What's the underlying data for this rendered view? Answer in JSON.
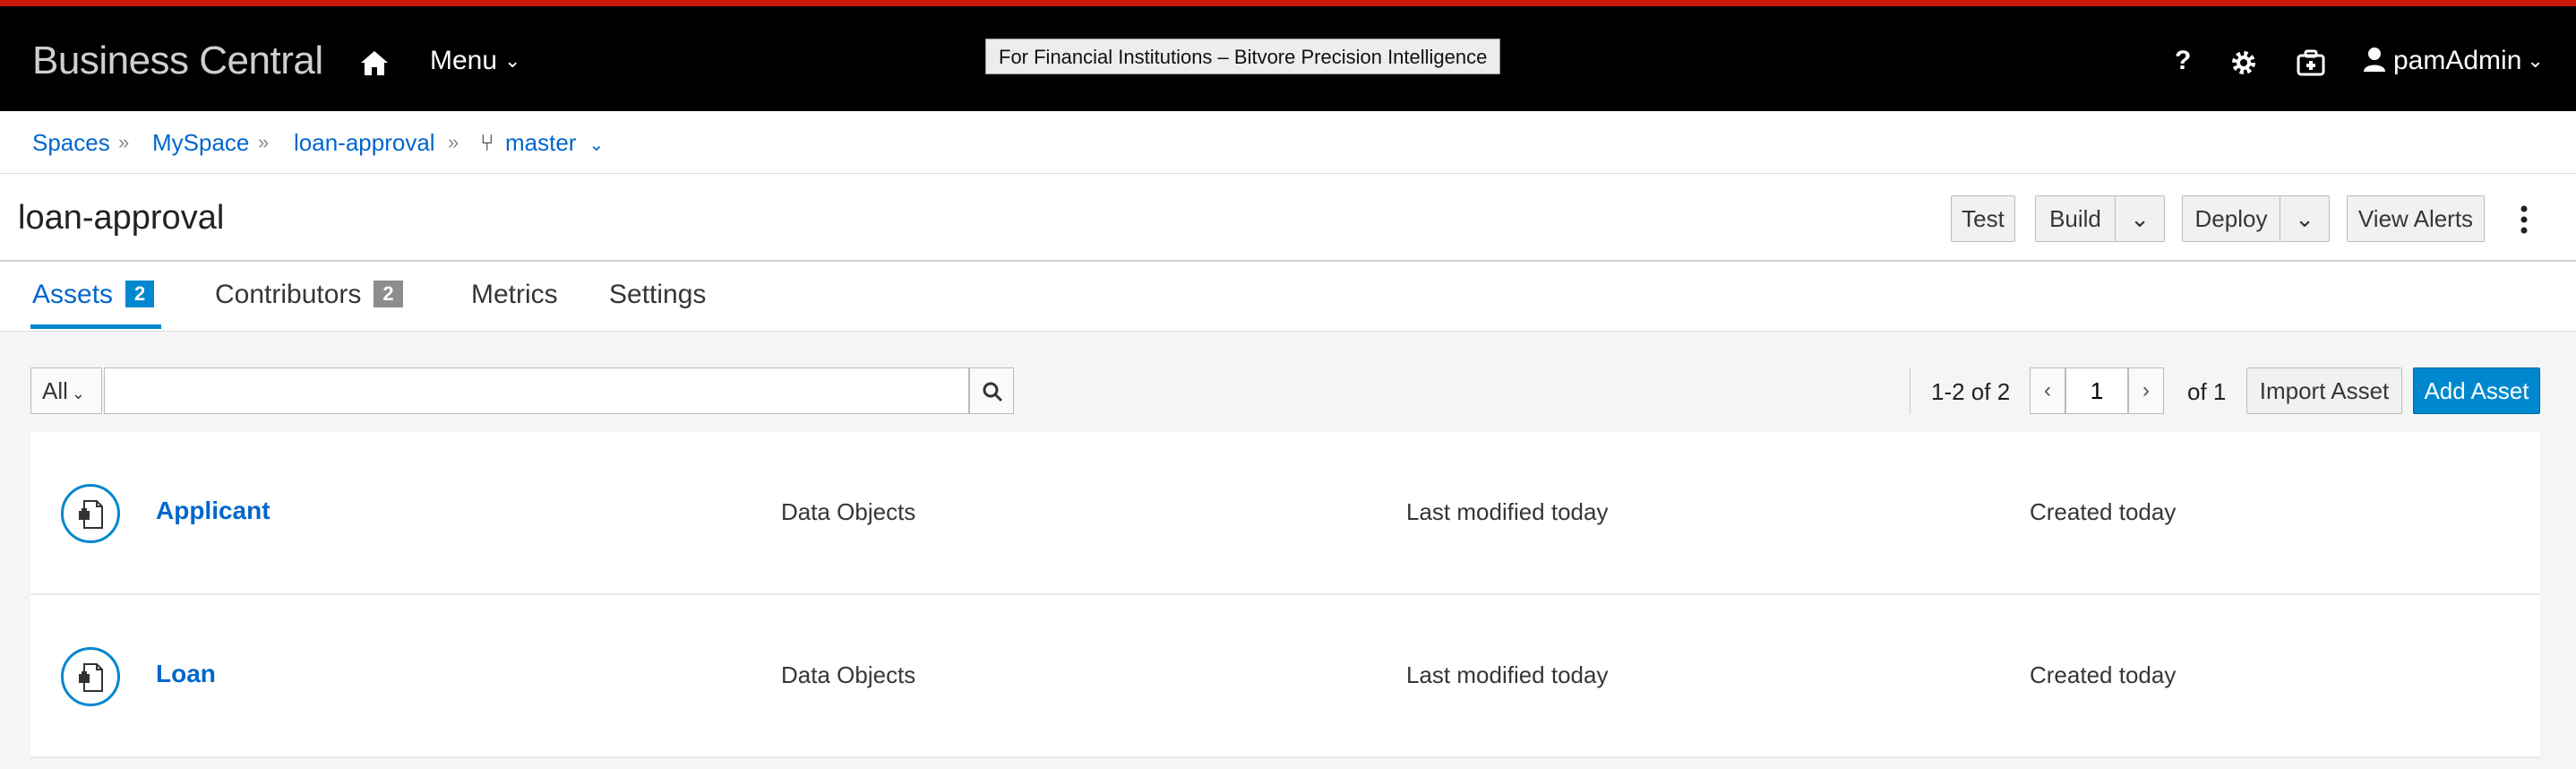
{
  "header": {
    "brand": "Business Central",
    "menu_label": "Menu",
    "banner": "For Financial Institutions – Bitvore Precision Intelligence",
    "help_label": "?",
    "user": "pamAdmin",
    "icons": [
      "home-icon",
      "help-icon",
      "gear-icon",
      "briefcase-icon",
      "user-icon"
    ],
    "accent_color": "#c9190b"
  },
  "breadcrumb": {
    "items": [
      "Spaces",
      "MySpace",
      "loan-approval"
    ],
    "branch": "master"
  },
  "project": {
    "title": "loan-approval",
    "actions": {
      "test": "Test",
      "build": "Build",
      "deploy": "Deploy",
      "view_alerts": "View Alerts"
    }
  },
  "tabs": [
    {
      "label": "Assets",
      "badge": "2",
      "active": true
    },
    {
      "label": "Contributors",
      "badge": "2",
      "active": false
    },
    {
      "label": "Metrics"
    },
    {
      "label": "Settings"
    }
  ],
  "toolbar": {
    "filter": "All",
    "search_value": "",
    "range": "1-2 of 2",
    "page": "1",
    "of_pages": "of 1",
    "import_label": "Import Asset",
    "add_label": "Add Asset",
    "primary_color": "#0088ce"
  },
  "assets": [
    {
      "name": "Applicant",
      "type": "Data Objects",
      "modified": "Last modified today",
      "created": "Created today"
    },
    {
      "name": "Loan",
      "type": "Data Objects",
      "modified": "Last modified today",
      "created": "Created today"
    }
  ]
}
